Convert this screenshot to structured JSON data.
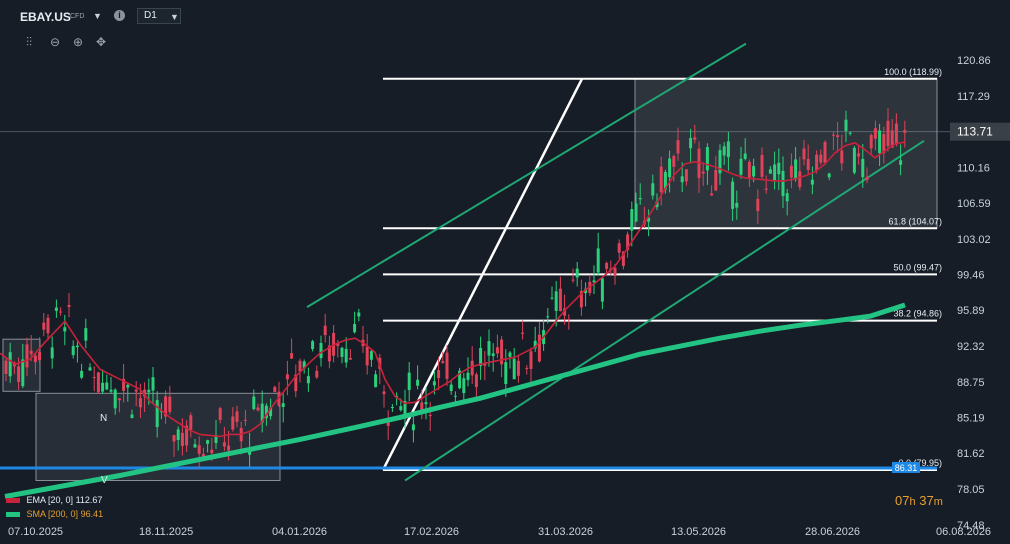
{
  "header": {
    "symbol": "EBAY.US",
    "symbol_sub": "CFD",
    "timeframe": "D1",
    "tools": [
      "candles-icon",
      "zoom-out-icon",
      "zoom-in-icon",
      "crosshair-icon"
    ]
  },
  "indicators": {
    "ema_label": "EMA [20, 0]",
    "ema_value": "112.67",
    "sma_label": "SMA [200, 0]",
    "sma_value": "96.41"
  },
  "timer": {
    "hours": "07",
    "h": "h",
    "minutes": "37",
    "m": "m"
  },
  "colors": {
    "background": "#161d26",
    "up_candle": "#2bd07a",
    "down_candle": "#e0425a",
    "ema": "#c8233a",
    "sma": "#23c483",
    "channel": "#1fa874",
    "support_line": "#1e88e5",
    "fib_lines": "#ffffff"
  },
  "chart_data": {
    "type": "candlestick",
    "x_ticks": [
      "07.10.2025",
      "18.11.2025",
      "04.01.2026",
      "17.02.2026",
      "31.03.2026",
      "13.05.2026",
      "28.06.2026",
      "06.08.2026"
    ],
    "y_ticks": [
      120.86,
      117.29,
      113.71,
      110.16,
      106.59,
      103.02,
      99.46,
      95.89,
      92.32,
      88.75,
      85.19,
      81.62,
      78.05,
      74.48
    ],
    "ylim": [
      74.48,
      122.5
    ],
    "current_price": 113.71,
    "last_label": "86.31",
    "grid": false,
    "fibonacci_levels": [
      {
        "label": "100.0 (118.99)",
        "value": 118.99
      },
      {
        "label": "61.8 (104.07)",
        "value": 104.07
      },
      {
        "label": "50.0 (99.47)",
        "value": 99.47
      },
      {
        "label": "38.2 (94.86)",
        "value": 94.86
      },
      {
        "label": "0.0 (79.95)",
        "value": 79.95
      }
    ],
    "support_level": 80.15,
    "annotations": [
      "N",
      "V"
    ],
    "series": [
      {
        "name": "EMA [20, 0]",
        "x": [
          0,
          15,
          30,
          45,
          65,
          80,
          100,
          120,
          140,
          150,
          170,
          190,
          200,
          210,
          220,
          230,
          240,
          250,
          260,
          270,
          280,
          295,
          310,
          320,
          335,
          345,
          355,
          365,
          375,
          385,
          395,
          405,
          415,
          425,
          440,
          450,
          460,
          470,
          480,
          490,
          505,
          515,
          525,
          535,
          545,
          555,
          565,
          575,
          585,
          595,
          605,
          615,
          625,
          635,
          645,
          655,
          665,
          675,
          685,
          695,
          705,
          715,
          725,
          735,
          745,
          755,
          765,
          775,
          785,
          795,
          805,
          815,
          825,
          835,
          845,
          855,
          865,
          875,
          885,
          895,
          905
        ],
        "values": [
          91.6,
          90.5,
          91.0,
          92.7,
          94.8,
          92.5,
          90.0,
          89.0,
          88.0,
          86.8,
          85.2,
          83.9,
          83.5,
          83.4,
          83.3,
          83.5,
          83.5,
          83.8,
          84.5,
          86.0,
          87.3,
          89.2,
          90.7,
          91.6,
          92.5,
          92.9,
          93.1,
          92.5,
          91.7,
          89.0,
          87.3,
          86.6,
          86.7,
          87.3,
          88.2,
          88.8,
          89.6,
          90.2,
          90.5,
          90.7,
          91.0,
          91.2,
          91.7,
          92.2,
          93.4,
          94.7,
          95.9,
          96.9,
          97.9,
          98.6,
          99.4,
          100.3,
          101.7,
          103.2,
          104.7,
          106.3,
          108.0,
          109.5,
          110.5,
          110.7,
          110.5,
          110.2,
          109.8,
          109.4,
          109.1,
          109.0,
          108.9,
          108.8,
          108.8,
          109.0,
          109.3,
          109.7,
          110.5,
          111.6,
          112.3,
          112.6,
          111.9,
          111.1,
          111.8,
          112.5,
          112.67
        ]
      },
      {
        "name": "SMA [200, 0]",
        "x": [
          5,
          60,
          120,
          180,
          240,
          300,
          360,
          400,
          440,
          480,
          520,
          560,
          600,
          640,
          680,
          720,
          760,
          800,
          840,
          870,
          905
        ],
        "values": [
          77.3,
          78.3,
          79.4,
          80.6,
          81.8,
          83.0,
          84.3,
          85.2,
          86.2,
          87.1,
          88.2,
          89.3,
          90.4,
          91.5,
          92.3,
          93.1,
          93.8,
          94.4,
          94.9,
          95.3,
          96.41
        ]
      }
    ]
  }
}
